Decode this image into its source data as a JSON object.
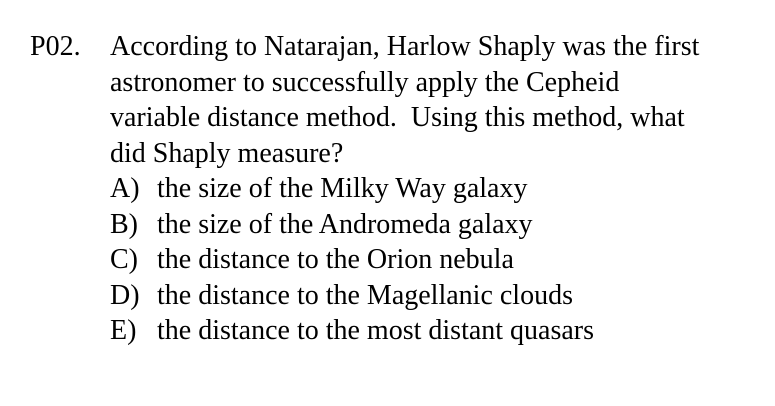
{
  "question": {
    "number": "P02.",
    "lines": [
      "According to Natarajan, Harlow Shaply was the first",
      "astronomer to successfully apply the Cepheid",
      "variable distance method.  Using this method, what",
      "did Shaply measure?"
    ],
    "choices": [
      {
        "letter": "A)",
        "text": "the size of the Milky Way galaxy"
      },
      {
        "letter": "B)",
        "text": "the size of the Andromeda galaxy"
      },
      {
        "letter": "C)",
        "text": "the distance to the Orion nebula"
      },
      {
        "letter": "D)",
        "text": "the distance to the Magellanic clouds"
      },
      {
        "letter": "E)",
        "text": "the distance to the most distant quasars"
      }
    ]
  }
}
